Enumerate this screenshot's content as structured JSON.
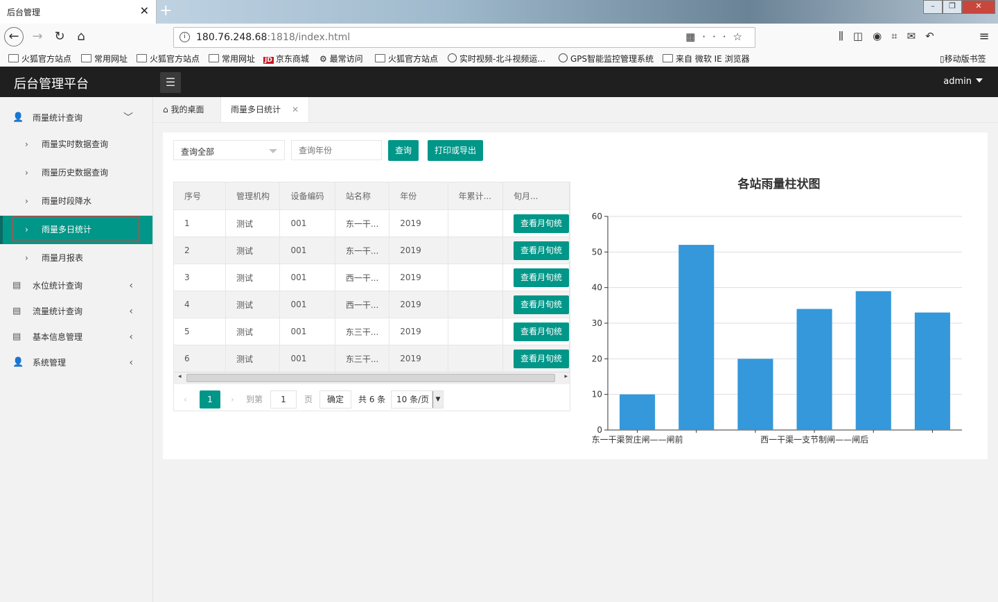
{
  "browser": {
    "tab_title": "后台管理",
    "url_host": "180.76.248.68",
    "url_rest": ":1818/index.html",
    "bookmarks": [
      "火狐官方站点",
      "常用网址",
      "火狐官方站点",
      "常用网址",
      "京东商城",
      "最常访问",
      "火狐官方站点",
      "实时视频-北斗视频运...",
      "GPS智能监控管理系统",
      "来自 微软 IE 浏览器"
    ],
    "mobile_bookmarks": "移动版书签"
  },
  "header": {
    "title": "后台管理平台",
    "user": "admin"
  },
  "sidebar": {
    "groups": [
      {
        "label": "雨量统计查询",
        "icon": "user-icon"
      },
      {
        "label": "水位统计查询",
        "icon": "doc-icon"
      },
      {
        "label": "流量统计查询",
        "icon": "doc-icon"
      },
      {
        "label": "基本信息管理",
        "icon": "doc-icon"
      },
      {
        "label": "系统管理",
        "icon": "user-icon"
      }
    ],
    "sub_items": [
      "雨量实时数据查询",
      "雨量历史数据查询",
      "雨量时段降水",
      "雨量多日统计",
      "雨量月报表"
    ],
    "active": "雨量多日统计"
  },
  "page_tabs": {
    "home": "我的桌面",
    "current": "雨量多日统计"
  },
  "filters": {
    "select_value": "查询全部",
    "year_placeholder": "查询年份",
    "query_label": "查询",
    "print_label": "打印或导出"
  },
  "table": {
    "headers": [
      "序号",
      "管理机构",
      "设备编码",
      "站名称",
      "年份",
      "年累计...",
      "旬月..."
    ],
    "button_label": "查看月旬统",
    "rows": [
      [
        "1",
        "测试",
        "001",
        "东一干...",
        "2019",
        ""
      ],
      [
        "2",
        "测试",
        "001",
        "东一干...",
        "2019",
        ""
      ],
      [
        "3",
        "测试",
        "001",
        "西一干...",
        "2019",
        ""
      ],
      [
        "4",
        "测试",
        "001",
        "西一干...",
        "2019",
        ""
      ],
      [
        "5",
        "测试",
        "001",
        "东三干...",
        "2019",
        ""
      ],
      [
        "6",
        "测试",
        "001",
        "东三干...",
        "2019",
        ""
      ]
    ]
  },
  "pager": {
    "current": "1",
    "goto": "到第",
    "page_input": "1",
    "page_unit": "页",
    "confirm": "确定",
    "total": "共 6 条",
    "per_page": "10 条/页"
  },
  "chart_data": {
    "type": "bar",
    "title": "各站雨量柱状图",
    "categories": [
      "东一干渠贺庄闸——闸前",
      "",
      "",
      "西一干渠一支节制闸——闸后",
      "",
      ""
    ],
    "values": [
      10,
      52,
      20,
      34,
      39,
      33
    ],
    "ylim": [
      0,
      60
    ],
    "yticks": [
      0,
      10,
      20,
      30,
      40,
      50,
      60
    ],
    "grid": true,
    "colors": {
      "bar": "#3498db",
      "axis": "#333333",
      "grid": "#dddddd"
    }
  }
}
